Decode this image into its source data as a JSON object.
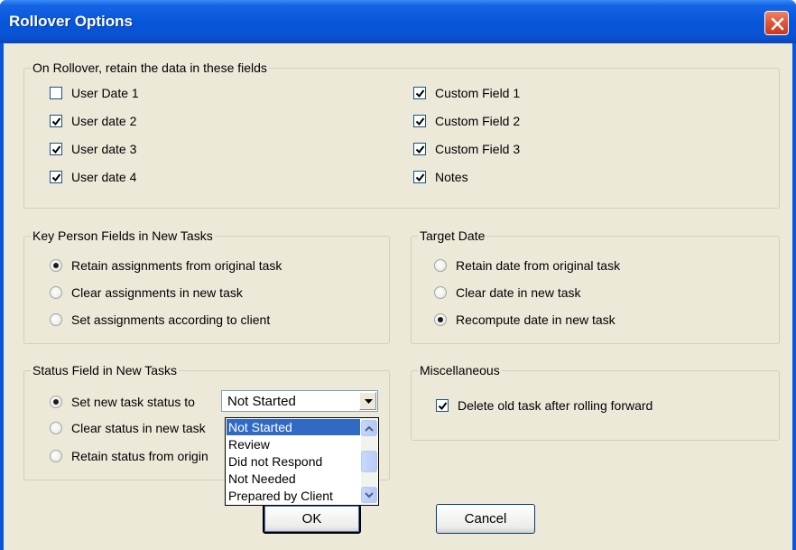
{
  "window": {
    "title": "Rollover Options"
  },
  "retain_group": {
    "legend": "On Rollover, retain the data in these fields",
    "left_items": [
      {
        "label": "User Date 1",
        "checked": false
      },
      {
        "label": "User date 2",
        "checked": true
      },
      {
        "label": "User date 3",
        "checked": true
      },
      {
        "label": "User date 4",
        "checked": true
      }
    ],
    "right_items": [
      {
        "label": "Custom Field 1",
        "checked": true
      },
      {
        "label": "Custom Field 2",
        "checked": true
      },
      {
        "label": "Custom Field 3",
        "checked": true
      },
      {
        "label": "Notes",
        "checked": true
      }
    ]
  },
  "key_person_group": {
    "legend": "Key Person Fields in New Tasks",
    "options": [
      {
        "label": "Retain assignments from original task",
        "selected": true
      },
      {
        "label": "Clear assignments in new task",
        "selected": false
      },
      {
        "label": "Set assignments according to client",
        "selected": false
      }
    ]
  },
  "target_date_group": {
    "legend": "Target Date",
    "options": [
      {
        "label": "Retain date from original task",
        "selected": false
      },
      {
        "label": "Clear date in new task",
        "selected": false
      },
      {
        "label": "Recompute date in new task",
        "selected": true
      }
    ]
  },
  "status_group": {
    "legend": "Status Field in New Tasks",
    "options": [
      {
        "label": "Set new task status to",
        "selected": true
      },
      {
        "label": "Clear status in new task",
        "selected": false
      },
      {
        "label": "Retain status from origin",
        "selected": false
      }
    ],
    "combo": {
      "value": "Not Started",
      "options": [
        "Not Started",
        "Review",
        "Did not Respond",
        "Not Needed",
        "Prepared by Client"
      ]
    }
  },
  "misc_group": {
    "legend": "Miscellaneous",
    "options": [
      {
        "label": "Delete old task after rolling forward",
        "checked": true
      }
    ]
  },
  "buttons": {
    "ok": "OK",
    "cancel": "Cancel"
  }
}
